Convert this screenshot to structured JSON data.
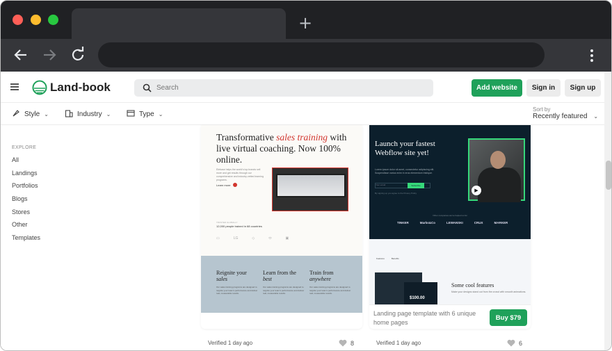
{
  "browser": {
    "colors": {
      "close": "#ff5f57",
      "minimize": "#febc2e",
      "maximize": "#28c840"
    },
    "new_tab_icon": "plus-icon",
    "nav_icons": [
      "back-arrow-icon",
      "forward-arrow-icon",
      "reload-icon"
    ],
    "menu_icon": "kebab-menu-icon"
  },
  "header": {
    "logo_text": "Land-book",
    "search_placeholder": "Search",
    "add_website": "Add website",
    "sign_in": "Sign in",
    "sign_up": "Sign up",
    "brand_color": "#1fa15a"
  },
  "filters": {
    "style": "Style",
    "industry": "Industry",
    "type": "Type",
    "sort_label": "Sort by",
    "sort_value": "Recently featured"
  },
  "sidebar": {
    "title": "EXPLORE",
    "items": [
      {
        "label": "All"
      },
      {
        "label": "Landings"
      },
      {
        "label": "Portfolios"
      },
      {
        "label": "Blogs"
      },
      {
        "label": "Stores"
      },
      {
        "label": "Other"
      },
      {
        "label": "Templates"
      }
    ]
  },
  "cards": [
    {
      "preview": {
        "headline_a": "Transformative ",
        "headline_em": "sales training",
        "headline_b": "with live virtual coaching. Now 100% online.",
        "body": "Elebase helps the world's top brands sell more and get results through our comprehensive and industry-vetted learning programs.",
        "cta": "Learn more",
        "meta_small": "TRUSTED GLOBALLY",
        "meta": "12,000 people trained in 68 countries",
        "logos": [
          "LG"
        ],
        "col1_h": "Reignite your",
        "col1_em": "sales",
        "col2_h": "Learn from the",
        "col2_em": "best",
        "col3_h": "Train from",
        "col3_em": "anywhere",
        "col_body": "Our sales training programs are designed to reignite your team's performance and deliver real, measurable results."
      },
      "verified": "Verified 1 day ago",
      "likes": "8"
    },
    {
      "preview": {
        "headline": "Launch your fastest Webflow site yet!",
        "body": "Lorem ipsum dolor sit amet, consectetur adipiscing elit. Suspendisse varius enim in eros elementum tristique.",
        "input_placeholder": "Your email",
        "subscribe": "Subscribe",
        "small": "By signing up you agree to the Privacy Policy",
        "logos_title": "Other companies we've helped so far",
        "logos": [
          "TINKER",
          "Marks&Co",
          "LEWANSKI",
          "CRUX",
          "MARKER"
        ],
        "nav": [
          "Features",
          "Benefits"
        ],
        "price": "$100.00",
        "right_title": "Some cool features",
        "right_body": "Make your designs stand out from the crowd with smooth animations."
      },
      "buy_text": "Landing page template with 6 unique home pages",
      "buy_button": "Buy $79",
      "verified": "Verified 1 day ago",
      "likes": "6"
    }
  ]
}
